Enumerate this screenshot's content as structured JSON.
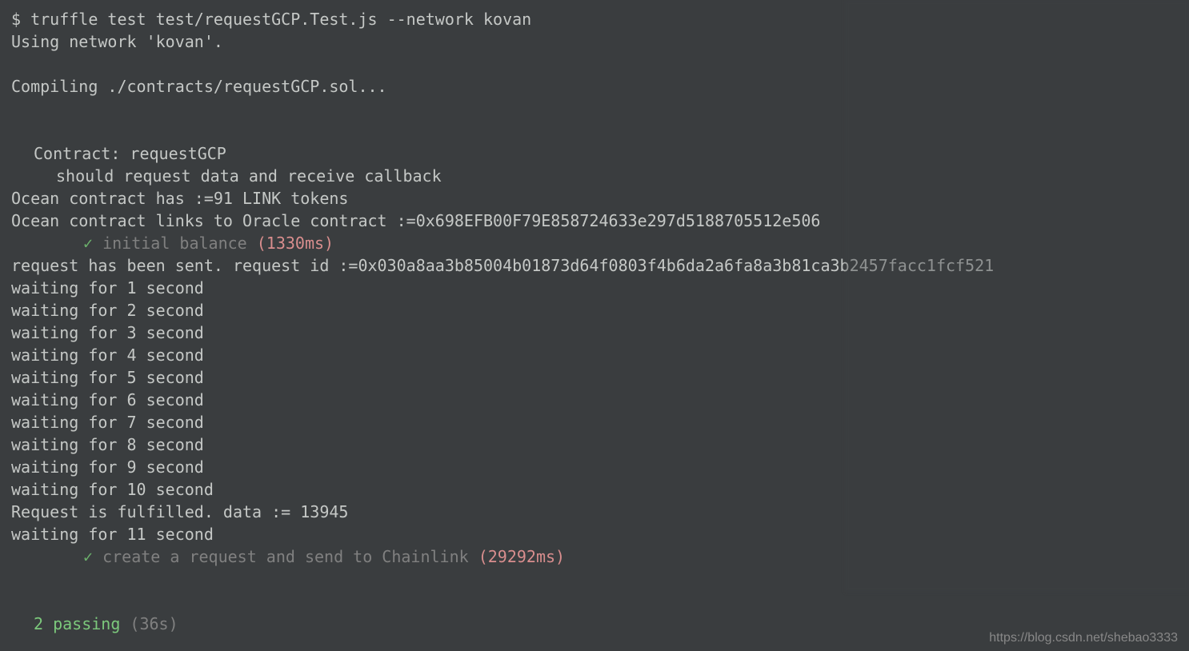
{
  "command": "$ truffle test test/requestGCP.Test.js --network kovan",
  "network_line": "Using network 'kovan'.",
  "compiling": "Compiling ./contracts/requestGCP.sol...",
  "contract_header": "Contract: requestGCP",
  "test_desc": "should request data and receive callback",
  "link_balance": "Ocean contract has :=91 LINK tokens",
  "oracle_link": "Ocean contract links to Oracle contract :=0x698EFB00F79E858724633e297d5188705512e506",
  "check1_text": "initial balance",
  "check1_duration": "(1330ms)",
  "request_sent": "request has been sent. request id :=0x030a8aa3b85004b01873d64f0803f4b6da2a6fa8a3b81ca3b2457facc1fcf521",
  "wait1": "waiting for 1 second",
  "wait2": "waiting for 2 second",
  "wait3": "waiting for 3 second",
  "wait4": "waiting for 4 second",
  "wait5": "waiting for 5 second",
  "wait6": "waiting for 6 second",
  "wait7": "waiting for 7 second",
  "wait8": "waiting for 8 second",
  "wait9": "waiting for 9 second",
  "wait10": "waiting for 10 second",
  "fulfilled": "Request is fulfilled. data := 13945",
  "wait11": "waiting for 11 second",
  "check2_text": "create a request and send to Chainlink",
  "check2_duration": "(29292ms)",
  "passing_count": "2 passing",
  "passing_time": "(36s)",
  "checkmark": "✓",
  "watermark": "https://blog.csdn.net/shebao3333"
}
